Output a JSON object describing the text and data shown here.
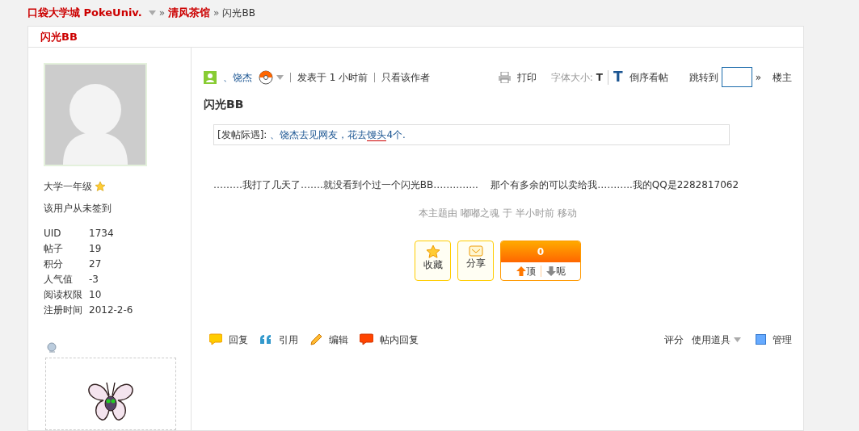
{
  "breadcrumb": [
    {
      "kind": "site",
      "text": "口袋大学城 PokeUniv."
    },
    {
      "kind": "sep",
      "text": "»"
    },
    {
      "kind": "link",
      "text": "清风茶馆"
    },
    {
      "kind": "sep",
      "text": "»"
    },
    {
      "kind": "current",
      "text": "闪光BB"
    }
  ],
  "thread_title": "闪光BB",
  "author": {
    "rank": "大学一年级",
    "sign_status": "该用户从未签到",
    "stats": [
      {
        "label": "UID",
        "value": "1734"
      },
      {
        "label": "帖子",
        "value": "19"
      },
      {
        "label": "积分",
        "value": "27"
      },
      {
        "label": "人气值",
        "value": "-3"
      },
      {
        "label": "阅读权限",
        "value": "10"
      },
      {
        "label": "注册时间",
        "value": "2012-2-6"
      }
    ]
  },
  "post": {
    "author_name": "、饶杰",
    "posted": "发表于 1 小时前",
    "only_author": "只看该作者",
    "print": "打印",
    "font_size_label": "字体大小:",
    "font_size_small": "T",
    "font_size_large": "T",
    "reverse": "倒序看帖",
    "jump_label": "跳转到",
    "jump_go": "»",
    "floor": "楼主",
    "title": "闪光BB",
    "notice": {
      "label": "[发帖际遇]:",
      "text": "、饶杰去见网友，花去",
      "item": "馒头",
      "count": "4个."
    },
    "body": "………我打了几天了…….就没看到个过一个闪光BB…………..    那个有多余的可以卖给我………..我的QQ是2282817062",
    "moved_note": "本主题由 嘟嘟之魂 于 半小时前 移动",
    "favorite": "收藏",
    "share": "分享",
    "vote_count": "0",
    "vote_up": "顶",
    "vote_down": "呃",
    "actions": [
      {
        "kind": "reply",
        "text": "回复"
      },
      {
        "kind": "quote",
        "text": "引用"
      },
      {
        "kind": "edit",
        "text": "编辑"
      },
      {
        "kind": "inner",
        "text": "帖内回复"
      }
    ],
    "rate": "评分",
    "tools": "使用道具",
    "manage": "管理"
  }
}
